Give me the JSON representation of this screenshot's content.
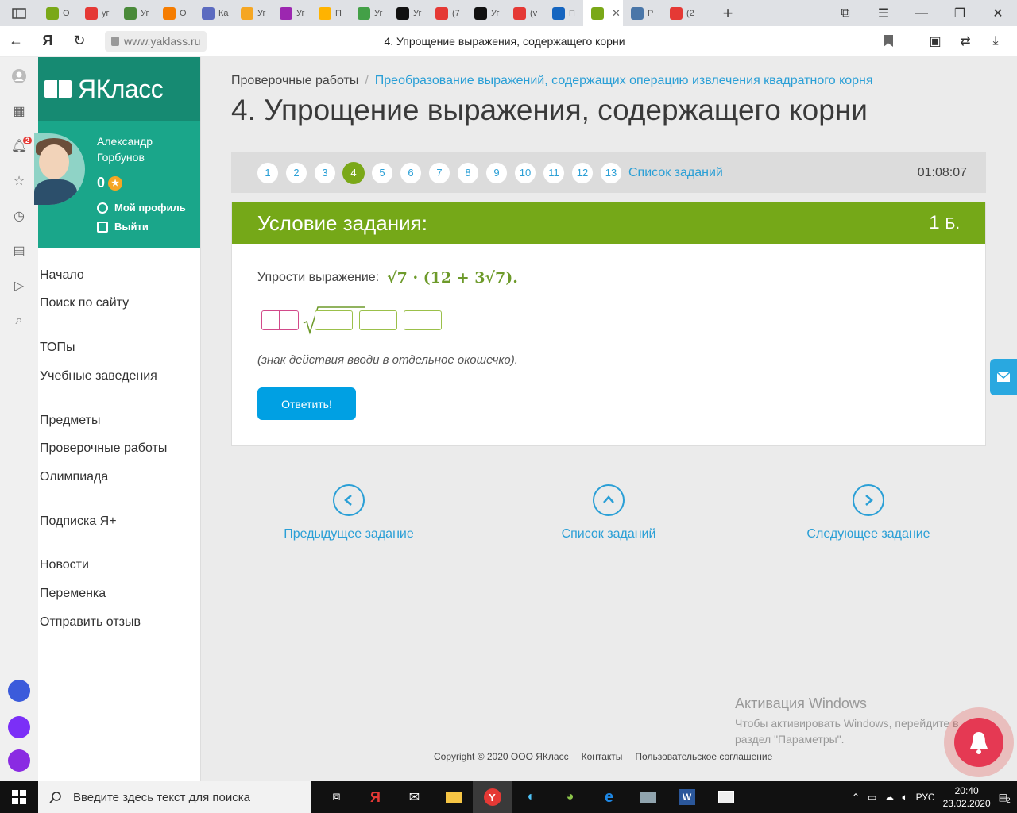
{
  "browser": {
    "tabs": [
      {
        "label": "О",
        "color": "#7aa818"
      },
      {
        "label": "уг",
        "color": "#e53935"
      },
      {
        "label": "Уг",
        "color": "#4a8a3a"
      },
      {
        "label": "О",
        "color": "#f57c00"
      },
      {
        "label": "Ка",
        "color": "#5c6bc0"
      },
      {
        "label": "Уг",
        "color": "#f5a623"
      },
      {
        "label": "Уг",
        "color": "#9c27b0"
      },
      {
        "label": "П",
        "color": "#ffb300"
      },
      {
        "label": "Уг",
        "color": "#43a047"
      },
      {
        "label": "Уг",
        "color": "#111111"
      },
      {
        "label": "(7",
        "color": "#e53935"
      },
      {
        "label": "Уг",
        "color": "#111111"
      },
      {
        "label": "(v",
        "color": "#e53935"
      },
      {
        "label": "П",
        "color": "#1565c0"
      },
      {
        "label": "",
        "color": "#7aa818"
      },
      {
        "label": "Р",
        "color": "#4a76a8"
      },
      {
        "label": "(2",
        "color": "#e53935"
      }
    ],
    "url": "www.yaklass.ru",
    "page_title": "4. Упрощение выражения, содержащего корни"
  },
  "profile": {
    "name": "Александр Горбунов",
    "score": "0",
    "my_profile": "Мой профиль",
    "logout": "Выйти"
  },
  "logo": "ЯКласс",
  "notification_count": "2",
  "menu": [
    "Начало",
    "Поиск по сайту",
    "ТОПы",
    "Учебные заведения",
    "Предметы",
    "Проверочные работы",
    "Олимпиада",
    "Подписка Я+",
    "Новости",
    "Переменка",
    "Отправить отзыв"
  ],
  "breadcrumb": {
    "first": "Проверочные работы",
    "sep": "/",
    "current": "Преобразование выражений, содержащих операцию извлечения квадратного корня"
  },
  "heading": "4. Упрощение выражения, содержащего корни",
  "task_numbers": [
    "1",
    "2",
    "3",
    "4",
    "5",
    "6",
    "7",
    "8",
    "9",
    "10",
    "11",
    "12",
    "13"
  ],
  "active_task": "4",
  "task_list_label": "Список заданий",
  "timer": "01:08:07",
  "task": {
    "header": "Условие задания:",
    "points": "1",
    "points_unit": "Б.",
    "prompt": "Упрости выражение:",
    "expression": "√7 · (12 + 3√7).",
    "hint": "(знак действия вводи в отдельное окошечко).",
    "submit": "Ответить!"
  },
  "nav": {
    "prev": "Предыдущее задание",
    "list": "Список заданий",
    "next": "Следующее задание"
  },
  "activation": {
    "title": "Активация Windows",
    "text1": "Чтобы активировать Windows, перейдите в",
    "text2": "раздел \"Параметры\"."
  },
  "footer": {
    "copyright": "Copyright © 2020 ООО ЯКласс",
    "contacts": "Контакты",
    "agreement": "Пользовательское соглашение"
  },
  "windows": {
    "search_placeholder": "Введите здесь текст для поиска",
    "lang": "РУС",
    "time": "20:40",
    "date": "23.02.2020",
    "notif_count": "2"
  }
}
